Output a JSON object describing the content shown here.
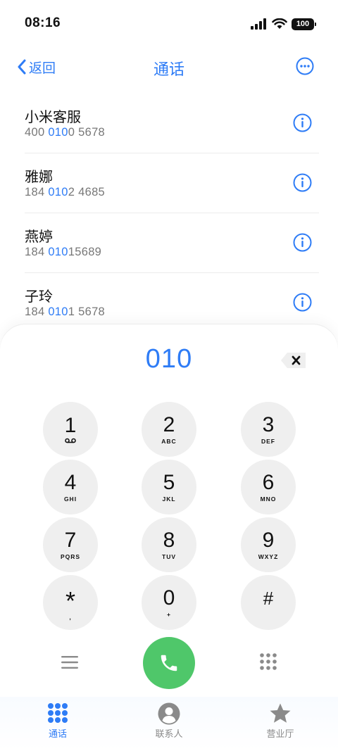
{
  "status_bar": {
    "time": "08:16",
    "battery": "100"
  },
  "nav": {
    "back_label": "返回",
    "title": "通话"
  },
  "contacts": [
    {
      "name": "小米客服",
      "number_parts": [
        "400 ",
        "010",
        "0 5678"
      ]
    },
    {
      "name": "雅娜",
      "number_parts": [
        "184 ",
        "010",
        "2 4685"
      ]
    },
    {
      "name": "燕婷",
      "number_parts": [
        "184 ",
        "010",
        "15689"
      ]
    },
    {
      "name": "子玲",
      "number_parts": [
        "184 ",
        "010",
        "1 5678"
      ]
    }
  ],
  "dialer": {
    "input": "010"
  },
  "keys": [
    {
      "digit": "1",
      "letters": ""
    },
    {
      "digit": "2",
      "letters": "ABC"
    },
    {
      "digit": "3",
      "letters": "DEF"
    },
    {
      "digit": "4",
      "letters": "GHI"
    },
    {
      "digit": "5",
      "letters": "JKL"
    },
    {
      "digit": "6",
      "letters": "MNO"
    },
    {
      "digit": "7",
      "letters": "PQRS"
    },
    {
      "digit": "8",
      "letters": "TUV"
    },
    {
      "digit": "9",
      "letters": "WXYZ"
    },
    {
      "digit": "*",
      "letters": ","
    },
    {
      "digit": "0",
      "letters": "+"
    },
    {
      "digit": "#",
      "letters": ""
    }
  ],
  "tabs": [
    {
      "label": "通话",
      "icon": "dots-grid-icon",
      "active": true
    },
    {
      "label": "联系人",
      "icon": "person-icon",
      "active": false
    },
    {
      "label": "营业厅",
      "icon": "star-icon",
      "active": false
    }
  ],
  "colors": {
    "accent": "#2e7cf6",
    "call": "#4fc76a",
    "key_bg": "#efefef",
    "inactive": "#8a8a8a"
  }
}
